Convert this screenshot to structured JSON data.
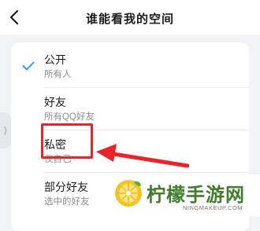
{
  "header": {
    "title": "谁能看我的空间"
  },
  "options": [
    {
      "label": "公开",
      "desc": "所有人",
      "selected": true
    },
    {
      "label": "好友",
      "desc": "所有QQ好友",
      "selected": false
    },
    {
      "label": "私密",
      "desc": "仅自己",
      "selected": false
    },
    {
      "label": "部分好友",
      "desc": "选中的好友",
      "selected": false
    }
  ],
  "icons": {
    "back": "chevron-left-icon",
    "check": "checkmark-icon",
    "side_handle": "chevron-right-icon"
  },
  "colors": {
    "check": "#2d9cf0",
    "annotation": "#e8232a",
    "watermark_text": "#3f7d2c"
  },
  "watermark": {
    "text": "柠檬手游网",
    "url": "NINGMAKEUP.COM"
  }
}
